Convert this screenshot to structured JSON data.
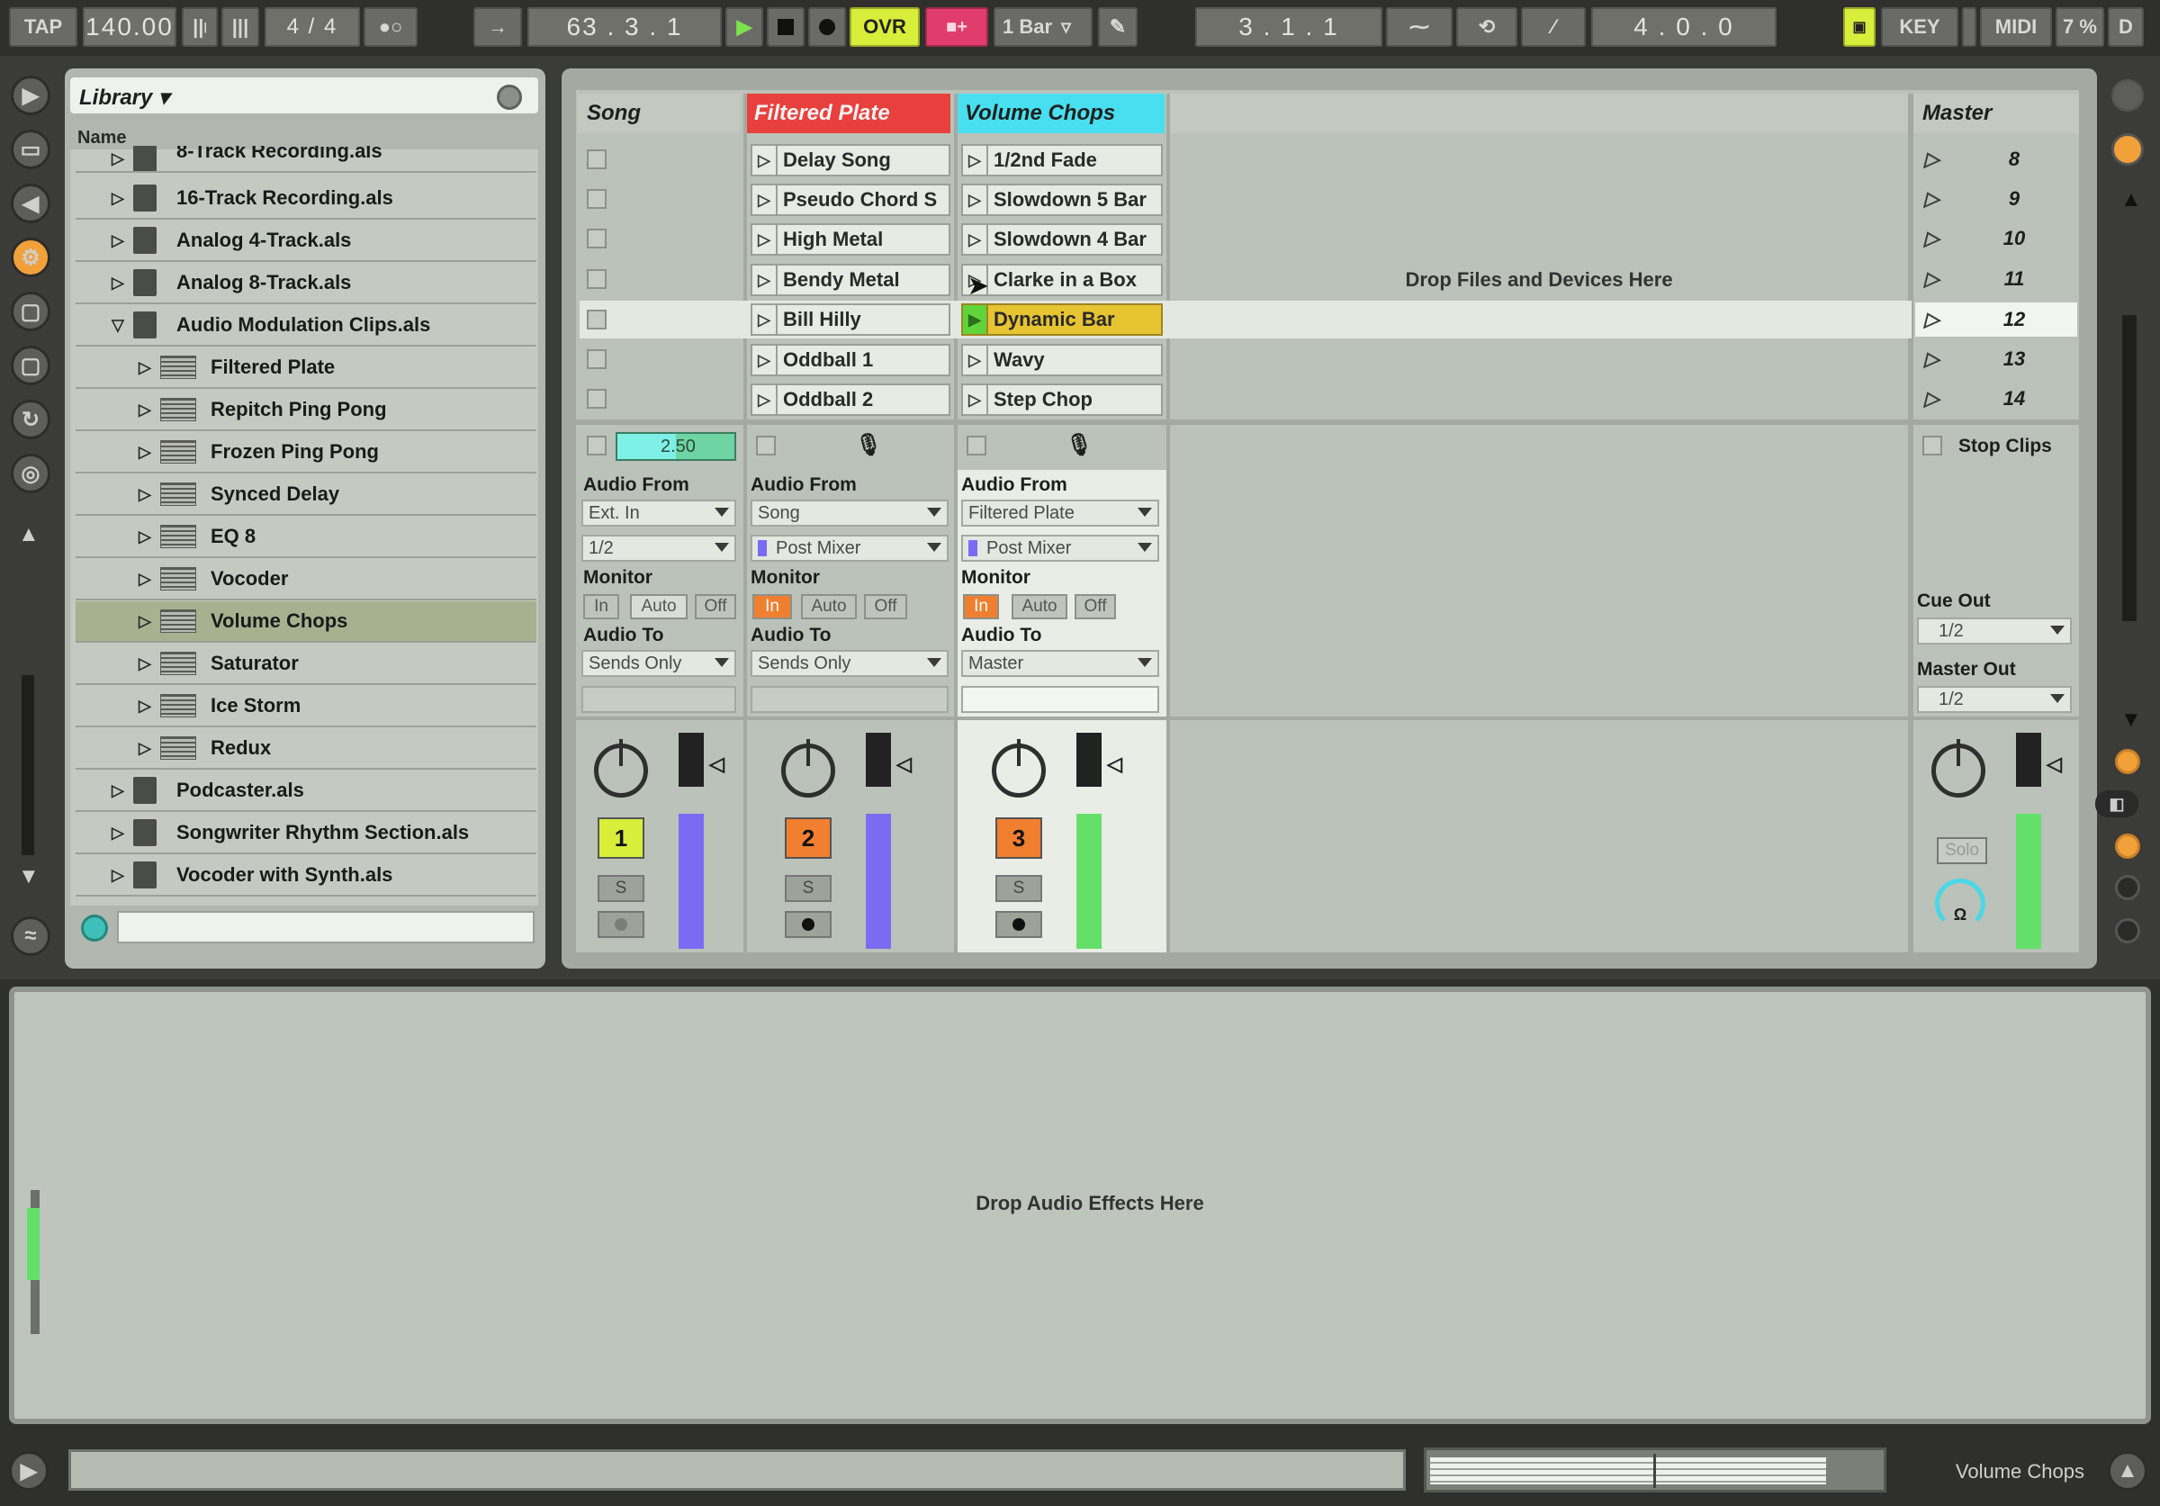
{
  "transport": {
    "tap": "TAP",
    "tempo": "140.00",
    "signature": "4 / 4",
    "position": "63 .   3 .   1",
    "ovr": "OVR",
    "quantize": "1 Bar",
    "loop_start": "3 .   1 .   1",
    "loop_length": "4 .   0 .   0",
    "key": "KEY",
    "midi": "MIDI",
    "cpu": "7 %",
    "d": "D"
  },
  "browser": {
    "title": "Library ▾",
    "column_name": "Name",
    "items": [
      {
        "label": "8-Track Recording.als",
        "kind": "file"
      },
      {
        "label": "16-Track Recording.als",
        "kind": "file"
      },
      {
        "label": "Analog 4-Track.als",
        "kind": "file"
      },
      {
        "label": "Analog 8-Track.als",
        "kind": "file"
      },
      {
        "label": "Audio Modulation Clips.als",
        "kind": "file",
        "expanded": true
      },
      {
        "label": "Filtered Plate",
        "kind": "device"
      },
      {
        "label": "Repitch Ping Pong",
        "kind": "device"
      },
      {
        "label": "Frozen Ping Pong",
        "kind": "device"
      },
      {
        "label": "Synced Delay",
        "kind": "device"
      },
      {
        "label": "EQ 8",
        "kind": "device"
      },
      {
        "label": "Vocoder",
        "kind": "device"
      },
      {
        "label": "Volume Chops",
        "kind": "device",
        "selected": true
      },
      {
        "label": "Saturator",
        "kind": "device"
      },
      {
        "label": "Ice Storm",
        "kind": "device"
      },
      {
        "label": "Redux",
        "kind": "device"
      },
      {
        "label": "Podcaster.als",
        "kind": "file"
      },
      {
        "label": "Songwriter Rhythm Section.als",
        "kind": "file"
      },
      {
        "label": "Vocoder with Synth.als",
        "kind": "file"
      }
    ],
    "search_value": ""
  },
  "session": {
    "tracks": [
      {
        "name": "Song",
        "color": "#bbc2b9",
        "clips": []
      },
      {
        "name": "Filtered Plate",
        "color": "#e8413d",
        "clips": [
          "Delay Song",
          "Pseudo Chord S",
          "High Metal",
          "Bendy Metal",
          "Bill Hilly",
          "Oddball 1",
          "Oddball 2"
        ]
      },
      {
        "name": "Volume Chops",
        "color": "#48e0f0",
        "clips": [
          "1/2nd Fade",
          "Slowdown 5 Bar",
          "Slowdown 4 Bar",
          "Clarke in a Box",
          "Dynamic Bar",
          "Wavy",
          "Step Chop"
        ]
      }
    ],
    "playing_clip": "Dynamic Bar",
    "playing_clip_color": "#e6c432",
    "drop_files_text": "Drop Files and Devices Here",
    "master_name": "Master",
    "scenes": [
      "8",
      "9",
      "10",
      "11",
      "12",
      "13",
      "14"
    ],
    "selected_scene": "12",
    "song_progress": "2.50",
    "stop_clips": "Stop Clips"
  },
  "io": {
    "audio_from_label": "Audio From",
    "monitor_label": "Monitor",
    "audio_to_label": "Audio To",
    "monitor_in": "In",
    "monitor_auto": "Auto",
    "monitor_off": "Off",
    "song": {
      "from": "Ext. In",
      "channel": "1/2",
      "to": "Sends Only",
      "monitor": "Auto"
    },
    "filtered_plate": {
      "from": "Song",
      "channel": "Post Mixer",
      "to": "Sends Only",
      "monitor": "In"
    },
    "volume_chops": {
      "from": "Filtered Plate",
      "channel": "Post Mixer",
      "to": "Master",
      "monitor": "In"
    },
    "cue_out_label": "Cue Out",
    "cue_out_value": "1/2",
    "master_out_label": "Master Out",
    "master_out_value": "1/2"
  },
  "mixer": {
    "track_numbers": [
      "1",
      "2",
      "3"
    ],
    "solo": "S",
    "master_solo": "Solo",
    "colors": {
      "active_yellow": "#d8ee3a",
      "active_orange": "#f07f30",
      "meter_blue": "#7a6cf2",
      "meter_green": "#64e06a"
    }
  },
  "detail": {
    "drop_effects_text": "Drop Audio Effects Here",
    "selected_track": "Volume Chops"
  }
}
